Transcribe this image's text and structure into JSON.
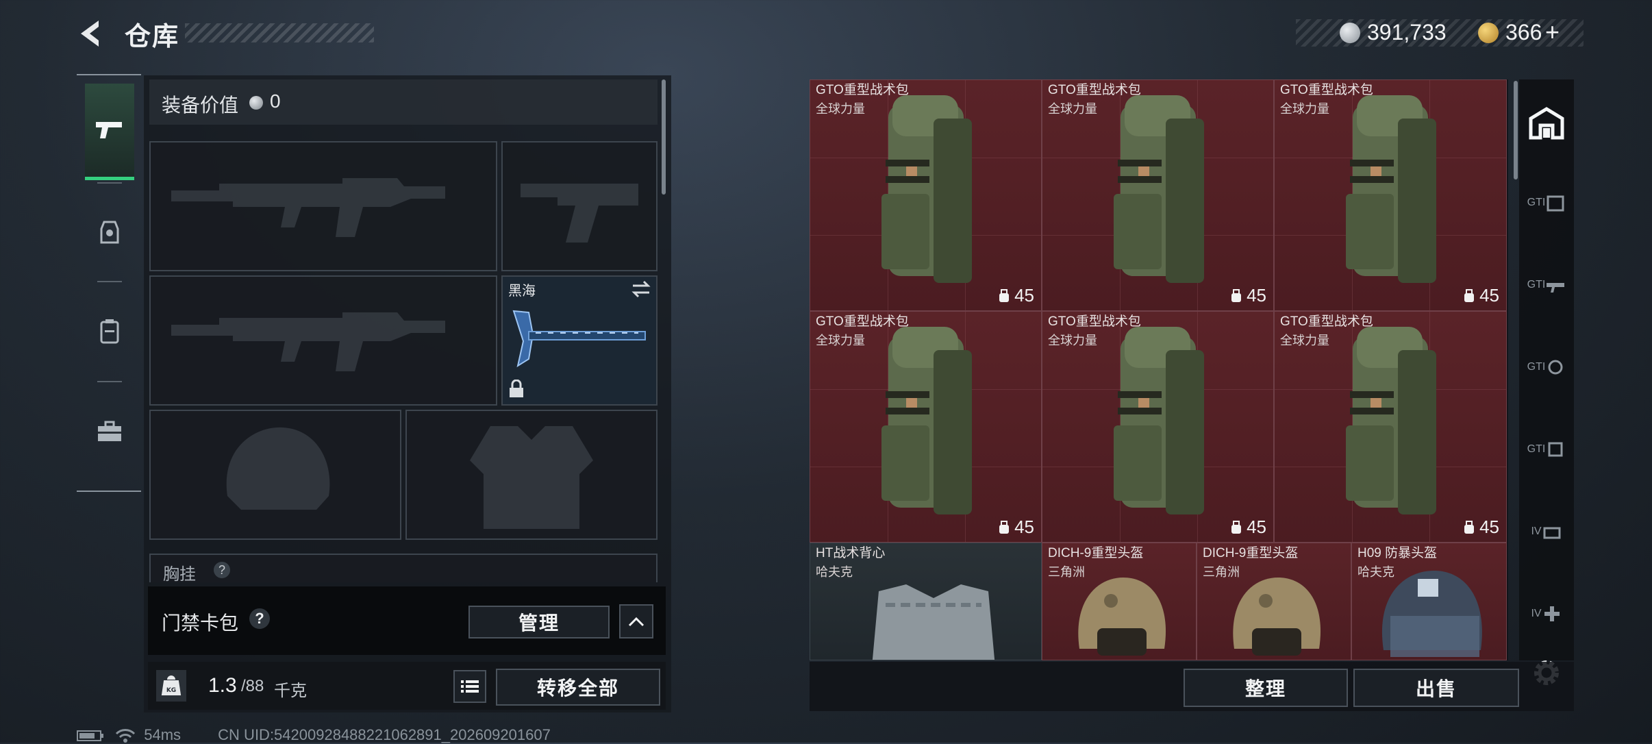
{
  "header": {
    "title": "仓库",
    "currency_silver": "391,733",
    "currency_gold": "366",
    "currency_add": "+"
  },
  "loadout": {
    "value_label": "装备价值",
    "value_amount": "0",
    "melee_name": "黑海",
    "chest_label": "胸挂",
    "card_pack_label": "门禁卡包",
    "card_pack_help": "?",
    "manage_button": "管理",
    "weight_current": "1.3",
    "weight_max": "/88",
    "weight_unit": "千克",
    "transfer_all_button": "转移全部"
  },
  "warehouse": {
    "items": [
      {
        "name": "GTO重型战术包",
        "sub": "全球力量",
        "capacity": "45"
      },
      {
        "name": "GTO重型战术包",
        "sub": "全球力量",
        "capacity": "45"
      },
      {
        "name": "GTO重型战术包",
        "sub": "全球力量",
        "capacity": "45"
      },
      {
        "name": "GTO重型战术包",
        "sub": "全球力量",
        "capacity": "45"
      },
      {
        "name": "GTO重型战术包",
        "sub": "全球力量",
        "capacity": "45"
      },
      {
        "name": "GTO重型战术包",
        "sub": "全球力量",
        "capacity": "45"
      },
      {
        "name": "HT战术背心",
        "sub": "哈夫克"
      },
      {
        "name": "DICH-9重型头盔",
        "sub": "三角洲"
      },
      {
        "name": "DICH-9重型头盔",
        "sub": "三角洲"
      },
      {
        "name": "H09 防暴头盔",
        "sub": "哈夫克"
      }
    ],
    "sort_button": "整理",
    "sell_button": "出售",
    "categories": [
      "GTI",
      "GTI",
      "GTI",
      "GTI",
      "IV",
      "IV"
    ]
  },
  "status": {
    "ping": "54ms",
    "uid": "CN UID:54200928488221062891_202609201607"
  },
  "colors": {
    "accent": "#35d07f",
    "item_red": "#5a2328"
  }
}
